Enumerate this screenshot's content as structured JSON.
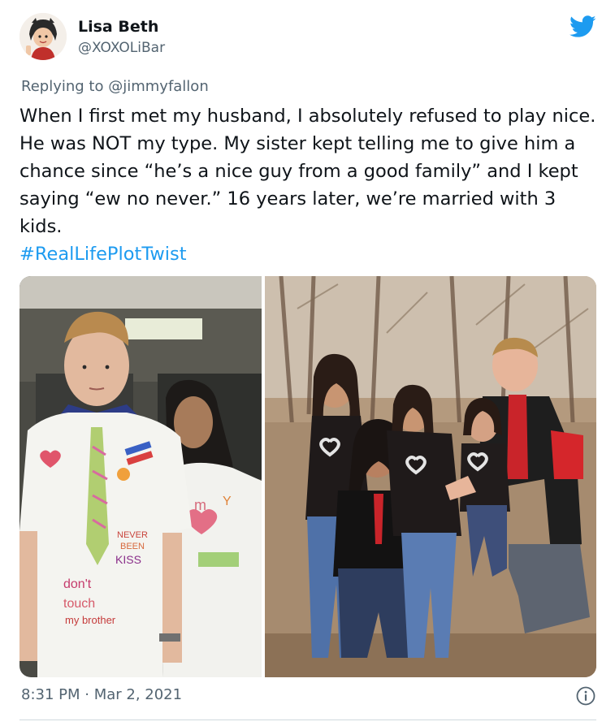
{
  "author": {
    "name": "Lisa Beth",
    "handle": "@XOXOLiBar"
  },
  "reply": {
    "prefix": "Replying to",
    "mention": "@jimmyfallon"
  },
  "tweet": {
    "text": "When I first met my husband, I absolutely refused to play nice. He was NOT my type. My sister kept telling me to give him a chance since “he’s a nice guy from a good family” and I kept saying “ew no never.” 16 years later, we’re married with 3 kids.",
    "hashtag": "#RealLifePlotTwist"
  },
  "media": {
    "left_shirt_text": [
      "NEVER",
      "BEEN",
      "KISS",
      "don't",
      "touch",
      "my brother"
    ],
    "right_shirt_text": [
      "m",
      "Y"
    ]
  },
  "meta": {
    "timestamp": "8:31 PM · Mar 2, 2021"
  },
  "icons": {
    "bird": "twitter-bird-icon",
    "info": "info-icon"
  },
  "colors": {
    "accent": "#1d9bf0",
    "text": "#0f1419",
    "secondary": "#536471"
  }
}
